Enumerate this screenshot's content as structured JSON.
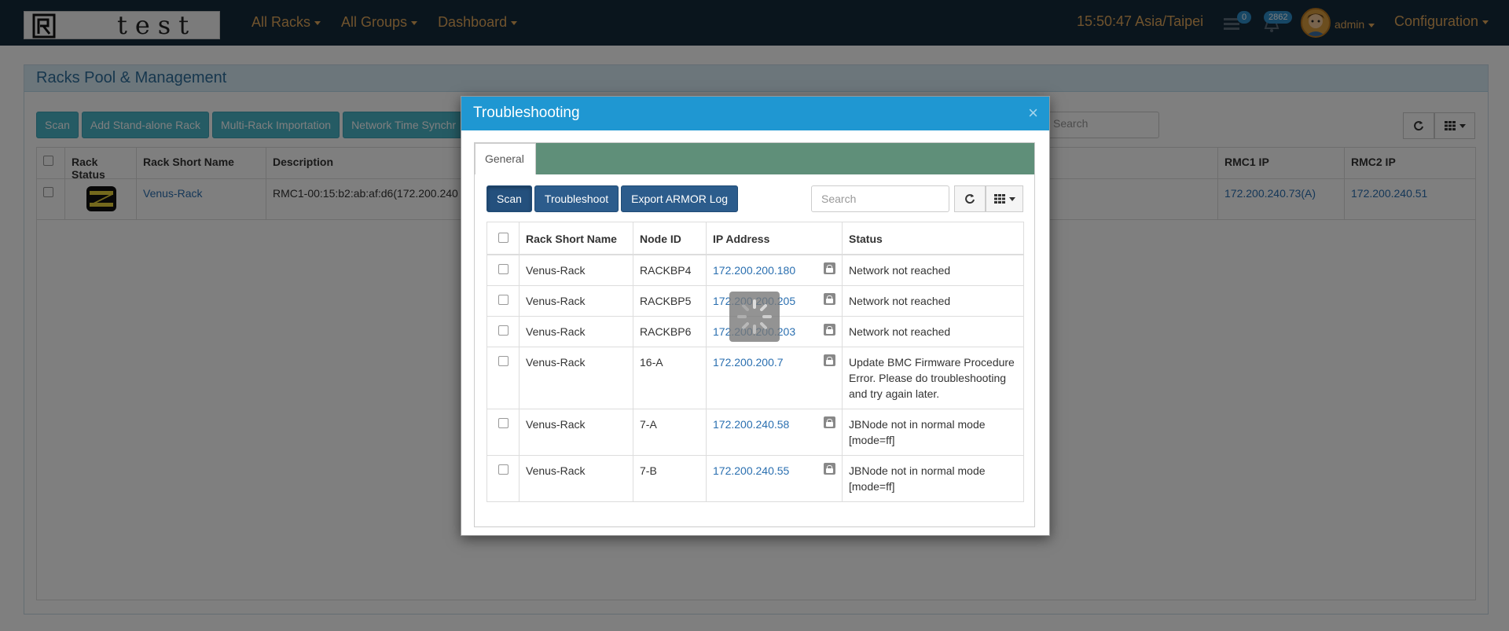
{
  "navbar": {
    "logo_text": "test",
    "menu": [
      {
        "label": "All Racks"
      },
      {
        "label": "All Groups"
      },
      {
        "label": "Dashboard"
      }
    ],
    "time": "15:50:47 Asia/Taipei",
    "tasks_badge": "0",
    "alerts_badge": "2862",
    "user": "admin",
    "config_label": "Configuration"
  },
  "page": {
    "title": "Racks Pool & Management",
    "toolbar": [
      "Scan",
      "Add Stand-alone Rack",
      "Multi-Rack Importation",
      "Network Time Synchr"
    ],
    "search_placeholder": "Search",
    "columns": {
      "rack_status": "Rack Status",
      "rack_short_name": "Rack Short Name",
      "description": "Description",
      "rmc1_ip": "RMC1 IP",
      "rmc2_ip": "RMC2 IP"
    },
    "row": {
      "name": "Venus-Rack",
      "description": "RMC1-00:15:b2:ab:af:d6(172.200.240",
      "rmc1_ip": "172.200.240.73(A)",
      "rmc2_ip": "172.200.240.51"
    }
  },
  "modal": {
    "title": "Troubleshooting",
    "close": "×",
    "tab": "General",
    "buttons": {
      "scan": "Scan",
      "troubleshoot": "Troubleshoot",
      "export": "Export ARMOR Log"
    },
    "search_placeholder": "Search",
    "columns": {
      "rack_short_name": "Rack Short Name",
      "node_id": "Node ID",
      "ip": "IP Address",
      "status": "Status"
    },
    "rows": [
      {
        "rack": "Venus-Rack",
        "node": "RACKBP4",
        "ip": "172.200.200.180",
        "status": "Network not reached"
      },
      {
        "rack": "Venus-Rack",
        "node": "RACKBP5",
        "ip": "172.200.200.205",
        "status": "Network not reached"
      },
      {
        "rack": "Venus-Rack",
        "node": "RACKBP6",
        "ip": "172.200.200.203",
        "status": "Network not reached"
      },
      {
        "rack": "Venus-Rack",
        "node": "16-A",
        "ip": "172.200.200.7",
        "status": "Update BMC Firmware Procedure Error. Please do troubleshooting and try again later."
      },
      {
        "rack": "Venus-Rack",
        "node": "7-A",
        "ip": "172.200.240.58",
        "status": "JBNode not in normal mode [mode=ff]"
      },
      {
        "rack": "Venus-Rack",
        "node": "7-B",
        "ip": "172.200.240.55",
        "status": "JBNode not in normal mode [mode=ff]"
      }
    ]
  }
}
